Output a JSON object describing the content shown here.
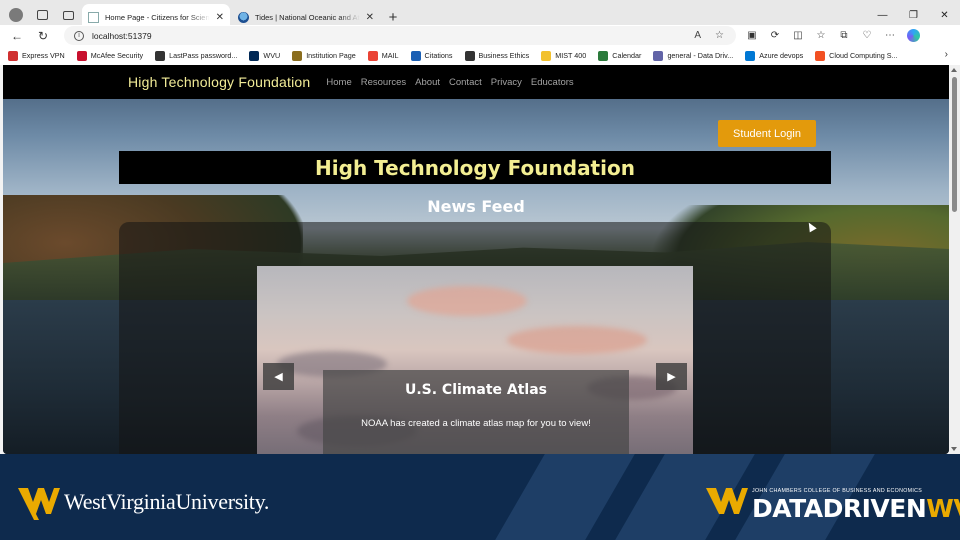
{
  "browser": {
    "tabs": [
      {
        "title": "Home Page - Citizens for Science",
        "active": true
      },
      {
        "title": "Tides | National Oceanic and Atmospheric",
        "active": false
      }
    ],
    "url": "localhost:51379",
    "bookmarks": [
      {
        "label": "Express VPN",
        "color": "#d03030"
      },
      {
        "label": "McAfee Security",
        "color": "#c8102e"
      },
      {
        "label": "LastPass password...",
        "color": "#333333"
      },
      {
        "label": "WVU",
        "color": "#002855"
      },
      {
        "label": "Institution Page",
        "color": "#8a6d1e"
      },
      {
        "label": "MAIL",
        "color": "#ea4335"
      },
      {
        "label": "Citations",
        "color": "#1a5fb4"
      },
      {
        "label": "Business Ethics",
        "color": "#333333"
      },
      {
        "label": "MIST 400",
        "color": "#f2c12e"
      },
      {
        "label": "Calendar",
        "color": "#2b7a3b"
      },
      {
        "label": "general - Data Driv...",
        "color": "#6264a7"
      },
      {
        "label": "Azure devops",
        "color": "#0078d4"
      },
      {
        "label": "Cloud Computing S...",
        "color": "#f25022"
      }
    ]
  },
  "site": {
    "brand": "High Technology Foundation",
    "nav": [
      "Home",
      "Resources",
      "About",
      "Contact",
      "Privacy",
      "Educators"
    ],
    "login_label": "Student Login",
    "banner_title": "High Technology Foundation",
    "feed_title": "News Feed",
    "carousel": {
      "title": "U.S. Climate Atlas",
      "text": "NOAA has created a climate atlas map for you to view!"
    }
  },
  "footer": {
    "university": "WestVirginiaUniversity.",
    "college": "JOHN CHAMBERS COLLEGE OF BUSINESS AND ECONOMICS",
    "brand_a": "DATADRIVEN",
    "brand_b": "WV"
  },
  "colors": {
    "accent_orange": "#e39a0c",
    "brand_yellow": "#f3ee92",
    "footer_navy": "#0e2a4d",
    "wv_gold": "#eaaa00"
  }
}
